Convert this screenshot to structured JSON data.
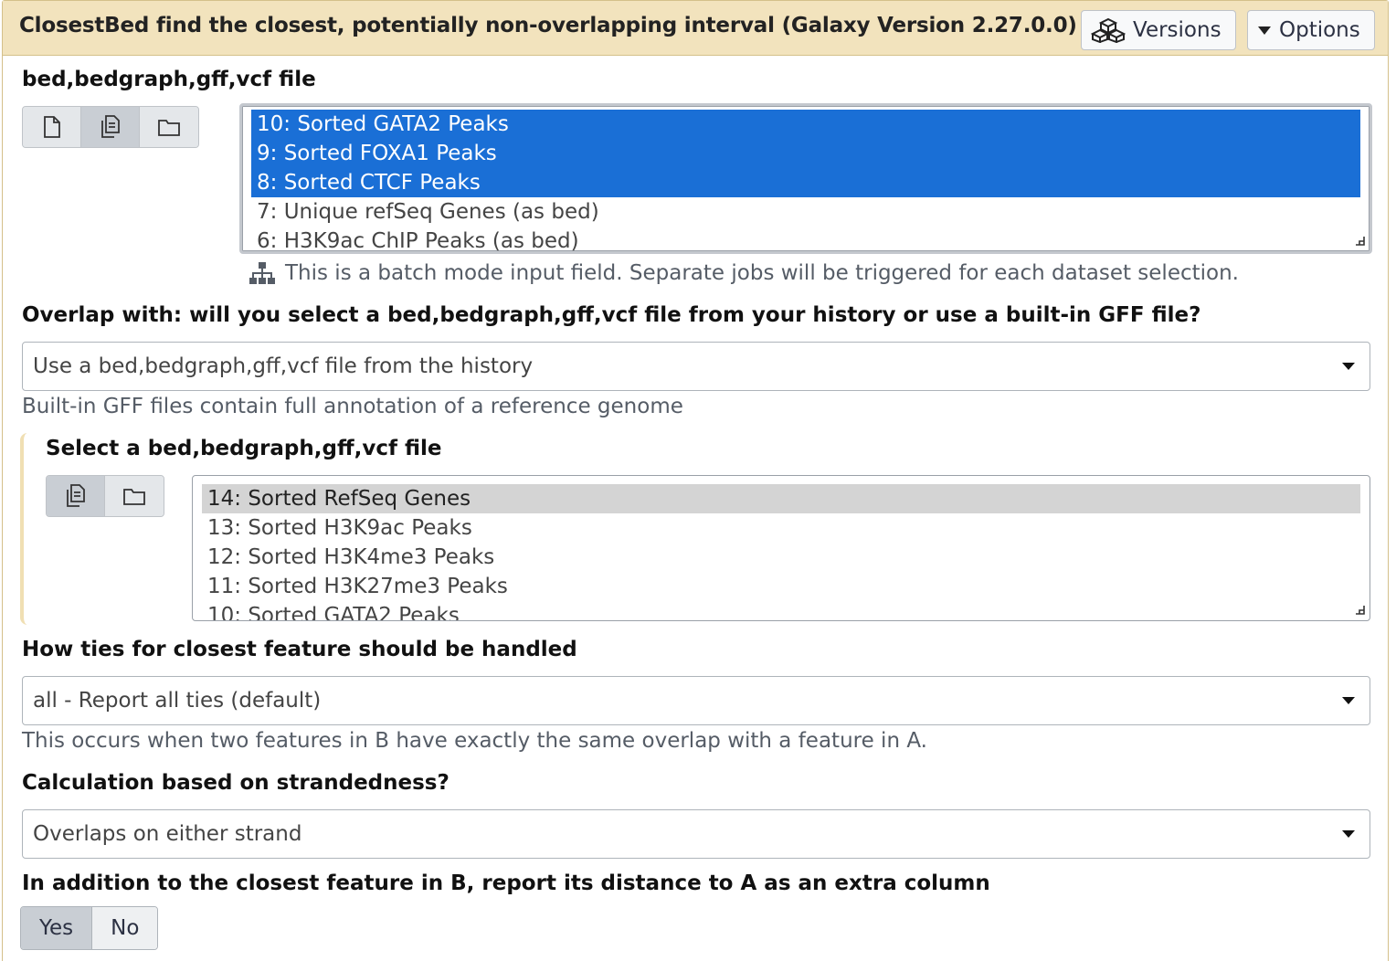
{
  "header": {
    "title": "ClosestBed find the closest, potentially non-overlapping interval (Galaxy Version 2.27.0.0)",
    "versions_label": "Versions",
    "options_label": "Options"
  },
  "input_a": {
    "label": "bed,bedgraph,gff,vcf file",
    "options": [
      "10: Sorted GATA2 Peaks",
      "9: Sorted FOXA1 Peaks",
      "8: Sorted CTCF Peaks",
      "7: Unique refSeq Genes (as bed)",
      "6: H3K9ac ChIP Peaks (as bed)"
    ],
    "selected": [
      0,
      1,
      2
    ],
    "batch_help": "This is a batch mode input field. Separate jobs will be triggered for each dataset selection."
  },
  "overlap": {
    "label": "Overlap with: will you select a bed,bedgraph,gff,vcf file from your history or use a built-in GFF file?",
    "value": "Use a bed,bedgraph,gff,vcf file from the history",
    "help": "Built-in GFF files contain full annotation of a reference genome"
  },
  "input_b": {
    "label": "Select a bed,bedgraph,gff,vcf file",
    "options": [
      "14: Sorted RefSeq Genes",
      "13: Sorted H3K9ac Peaks",
      "12: Sorted H3K4me3 Peaks",
      "11: Sorted H3K27me3 Peaks",
      "10: Sorted GATA2 Peaks"
    ]
  },
  "ties": {
    "label": "How ties for closest feature should be handled",
    "value": "all - Report all ties (default)",
    "help": "This occurs when two features in B have exactly the same overlap with a feature in A."
  },
  "strand": {
    "label": "Calculation based on strandedness?",
    "value": "Overlaps on either strand"
  },
  "distance": {
    "label": "In addition to the closest feature in B, report its distance to A as an extra column",
    "yes": "Yes",
    "no": "No"
  }
}
